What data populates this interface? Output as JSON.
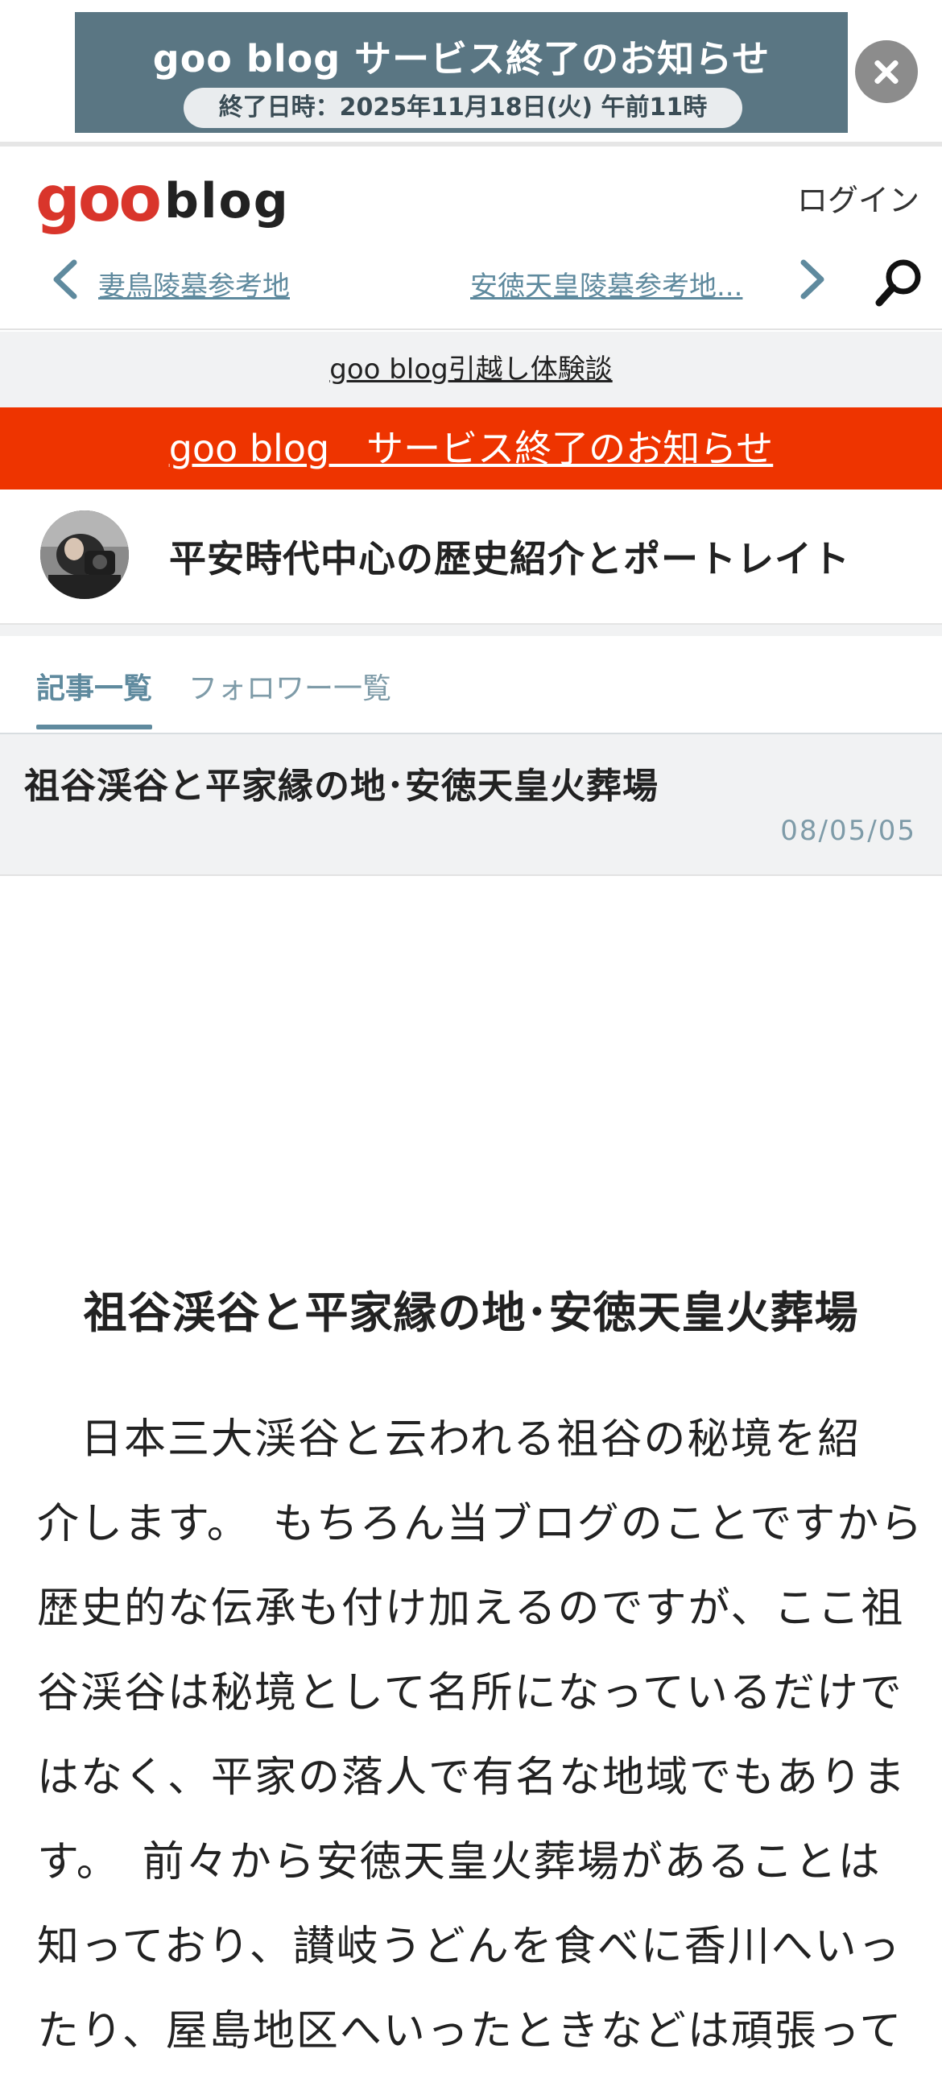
{
  "banner": {
    "title": "goo blog サービス終了のお知らせ",
    "date": "終了日時：2025年11月18日(火) 午前11時"
  },
  "header": {
    "logo_goo": "goo",
    "logo_blog": "blog",
    "login": "ログイン",
    "prev_article": "妻鳥陵墓参考地",
    "next_article": "安徳天皇陵墓参考地..."
  },
  "moving_link": "goo blog引越し体験談",
  "notice_link": "goo blog　サービス終了のお知らせ",
  "blog": {
    "title": "平安時代中心の歴史紹介とポートレイト"
  },
  "tabs": {
    "articles": "記事一覧",
    "followers": "フォロワー一覧"
  },
  "article": {
    "header_title": "祖谷渓谷と平家縁の地･安徳天皇火葬場",
    "date": "08/05/05",
    "title": "祖谷渓谷と平家縁の地･安徳天皇火葬場",
    "lines": [
      "　日本三大渓谷と云われる祖谷の秘境を紹",
      "介します。　もちろん当ブログのことですから",
      "歴史的な伝承も付け加えるのですが、ここ祖",
      "谷渓谷は秘境として名所になっているだけで",
      "はなく、平家の落人で有名な地域でもありま",
      "す。　前々から安徳天皇火葬場があることは",
      "知っており、讃岐うどんを食べに香川へいっ",
      "たり、屋島地区へいったときなどは頑張って"
    ]
  },
  "colors": {
    "banner_bg": "#5a7683",
    "notice_red": "#ee3400",
    "accent_blue": "#5f8a9e",
    "goo_red": "#d9352b"
  }
}
